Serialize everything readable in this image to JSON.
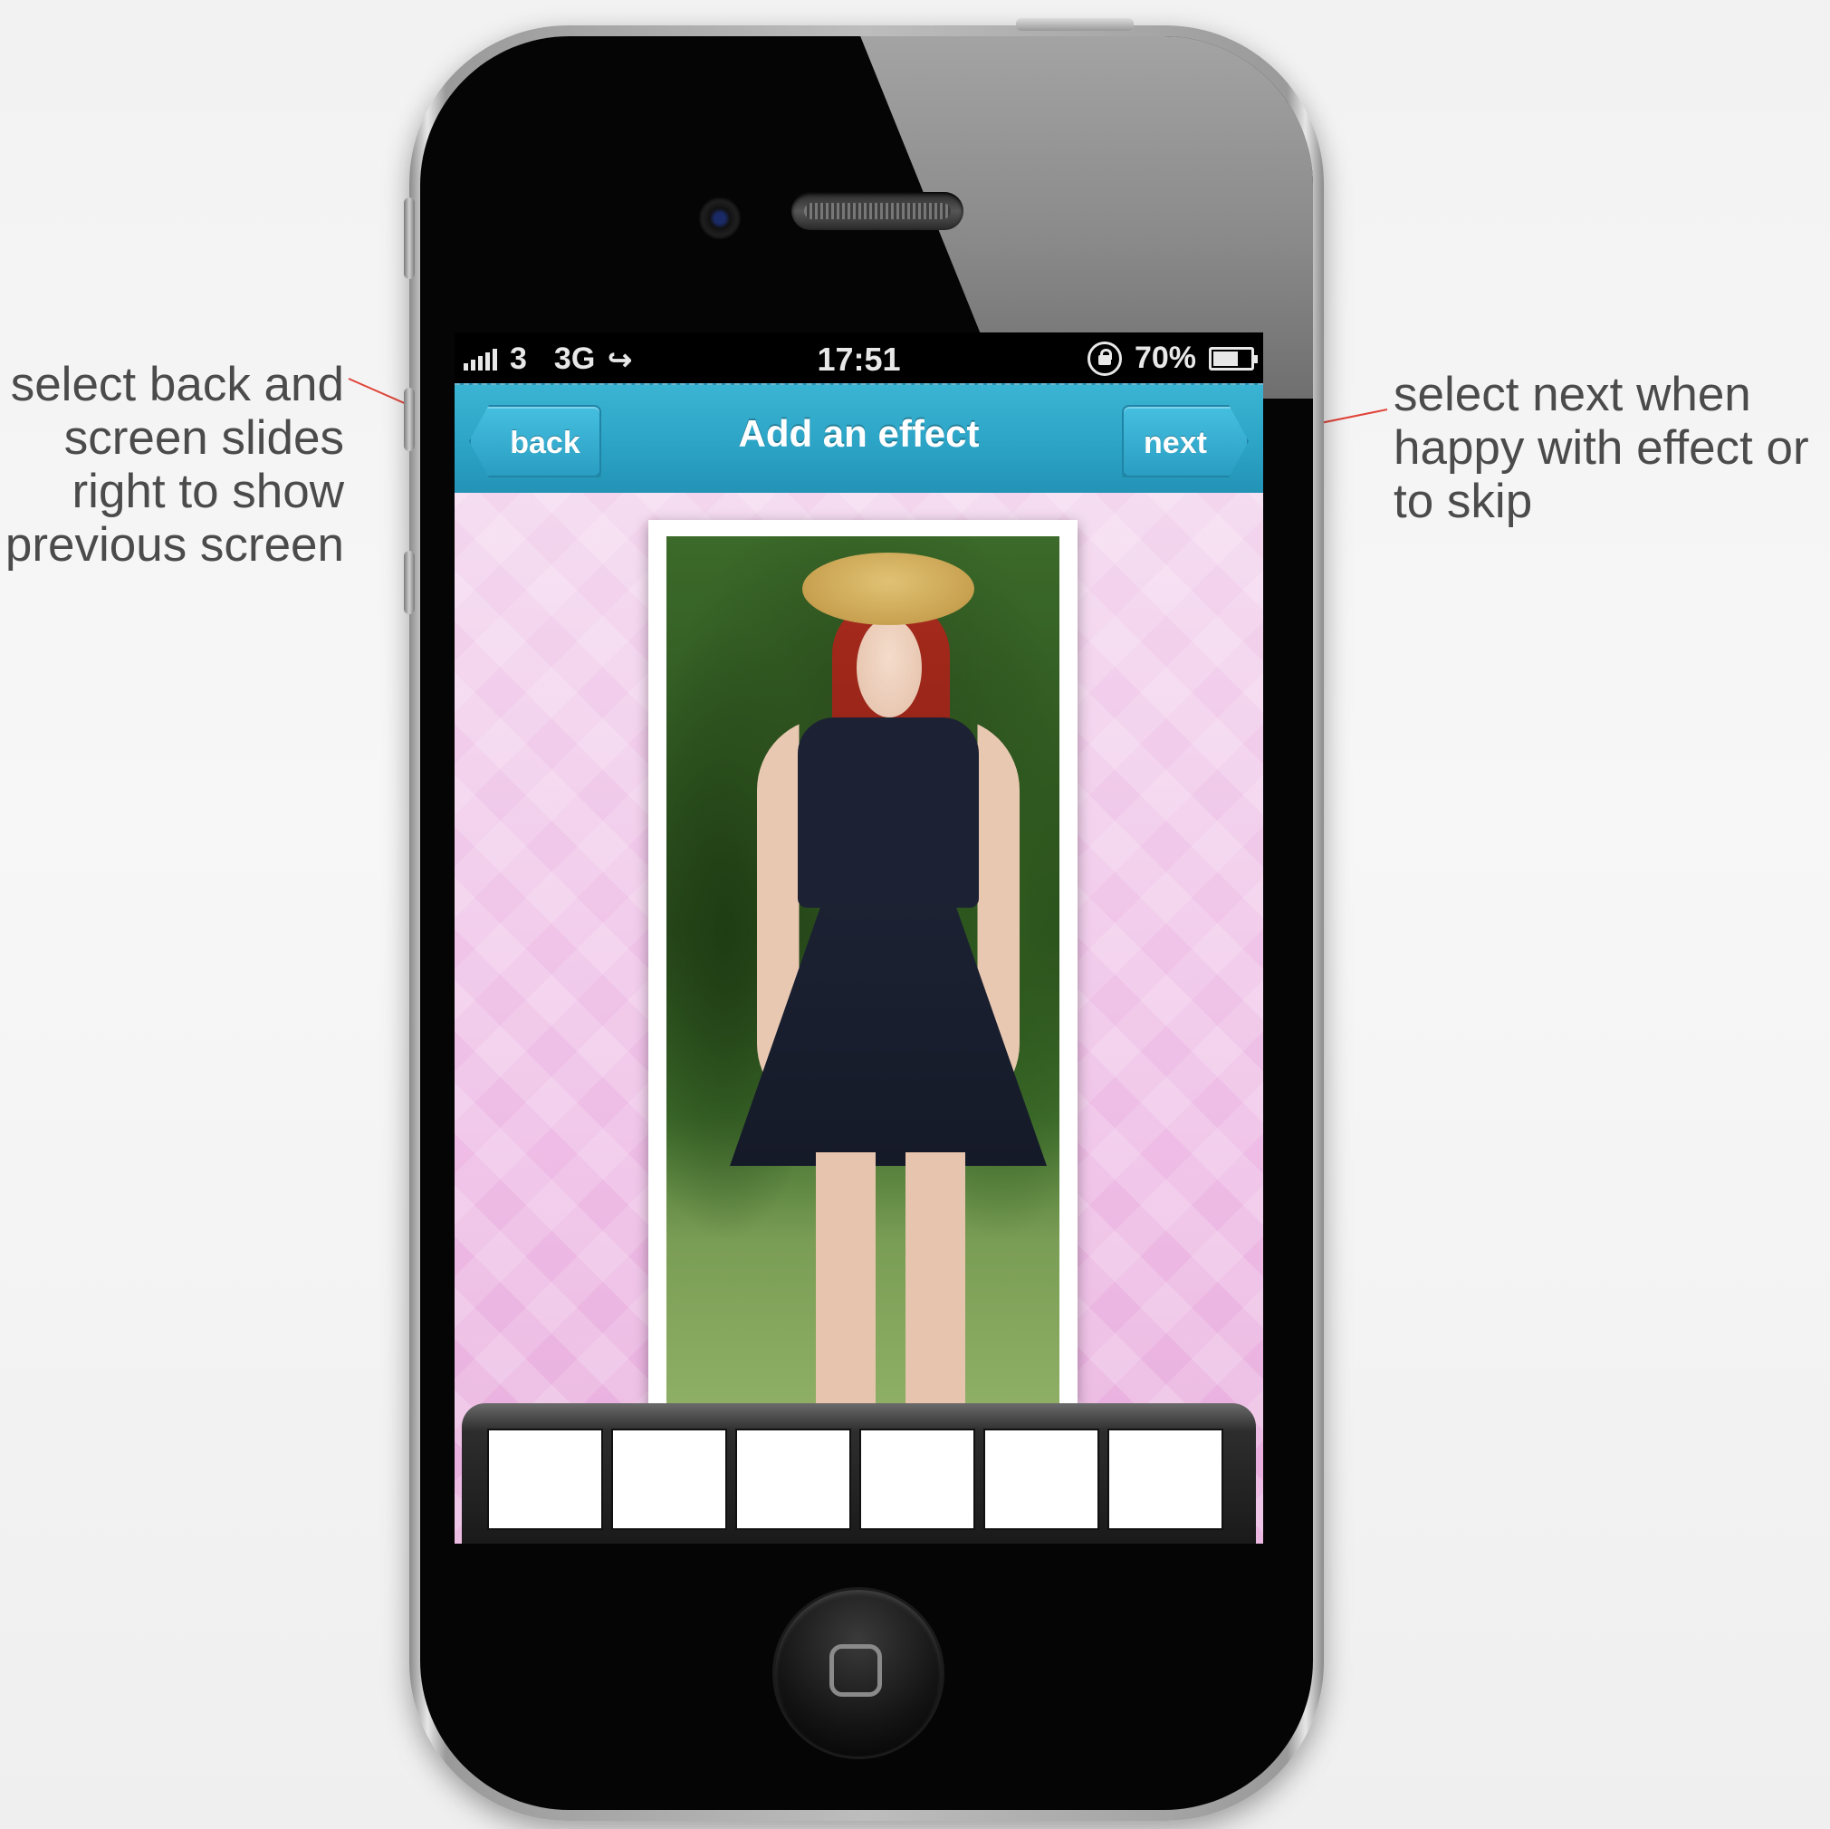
{
  "annotations": {
    "left": [
      "select back and",
      "screen slides",
      "right to show",
      "previous screen"
    ],
    "right": [
      "select next when",
      "happy with effect or",
      "to skip"
    ],
    "leader_color": "#e0443a"
  },
  "status_bar": {
    "carrier": "3",
    "network": "3G",
    "time": "17:51",
    "battery_percent": "70%",
    "battery_level": 0.7,
    "icons": [
      "signal-bars-icon",
      "call-forward-icon",
      "rotation-lock-icon",
      "battery-icon"
    ]
  },
  "nav": {
    "title": "Add an effect",
    "back_label": "back",
    "next_label": "next",
    "color": "#2ca4c6"
  },
  "effects": {
    "slot_count": 6,
    "slots": [
      "",
      "",
      "",
      "",
      "",
      ""
    ]
  },
  "colors": {
    "background": "#f5f5f5",
    "content_pink": "#eebde6"
  }
}
